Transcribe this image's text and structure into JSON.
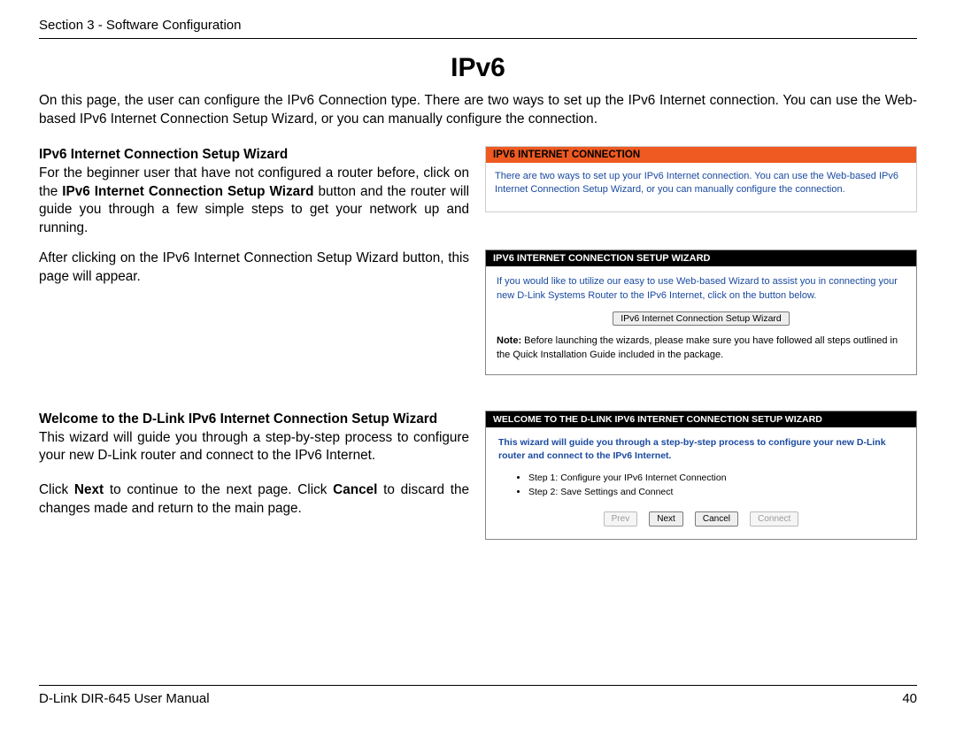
{
  "header": {
    "section": "Section 3 - Software Configuration"
  },
  "title": "IPv6",
  "intro": "On this page, the user can configure the IPv6 Connection type. There are two ways to set up the IPv6 Internet connection. You can use the Web-based IPv6 Internet Connection Setup Wizard, or you can manually configure the connection.",
  "blockA": {
    "heading": "IPv6 Internet Connection Setup Wizard",
    "p1_a": "For the beginner user that have not configured a router before, click on the ",
    "p1_bold": "IPv6 Internet Connection Setup Wizard",
    "p1_b": " button and the router will guide you through a few simple steps to get your network up and running.",
    "p2": "After clicking on the IPv6 Internet Connection Setup Wizard button, this page will appear."
  },
  "panel1": {
    "header": "IPV6 INTERNET CONNECTION",
    "body": "There are two ways to set up your IPv6 Internet connection. You can use the Web-based IPv6 Internet Connection Setup Wizard, or you can manually configure the connection."
  },
  "panel2": {
    "header": "IPV6 INTERNET CONNECTION SETUP WIZARD",
    "body1": "If you would like to utilize our easy to use Web-based Wizard to assist you in connecting your new D-Link Systems Router to the IPv6 Internet, click on the button below.",
    "button": "IPv6 Internet Connection Setup Wizard",
    "note_label": "Note:",
    "note_body": " Before launching the wizards, please make sure you have followed all steps outlined in the Quick Installation Guide included in the package."
  },
  "blockB": {
    "heading": "Welcome to the D-Link IPv6 Internet Connection Setup Wizard",
    "p1": "This wizard will guide you through a step-by-step process to configure your new D-Link router and connect to the IPv6 Internet.",
    "p2_a": "Click ",
    "p2_next": "Next",
    "p2_b": " to continue to the next page. Click ",
    "p2_cancel": "Cancel",
    "p2_c": " to discard the changes made and return to the main page."
  },
  "panel3": {
    "header": "WELCOME TO THE D-LINK IPV6 INTERNET CONNECTION SETUP WIZARD",
    "intro": "This wizard will guide you through a step-by-step process to configure your new D-Link router and connect to the IPv6 Internet.",
    "steps": [
      "Step 1: Configure your IPv6 Internet Connection",
      "Step 2: Save Settings and Connect"
    ],
    "buttons": {
      "prev": "Prev",
      "next": "Next",
      "cancel": "Cancel",
      "connect": "Connect"
    }
  },
  "footer": {
    "left": "D-Link DIR-645 User Manual",
    "page": "40"
  }
}
